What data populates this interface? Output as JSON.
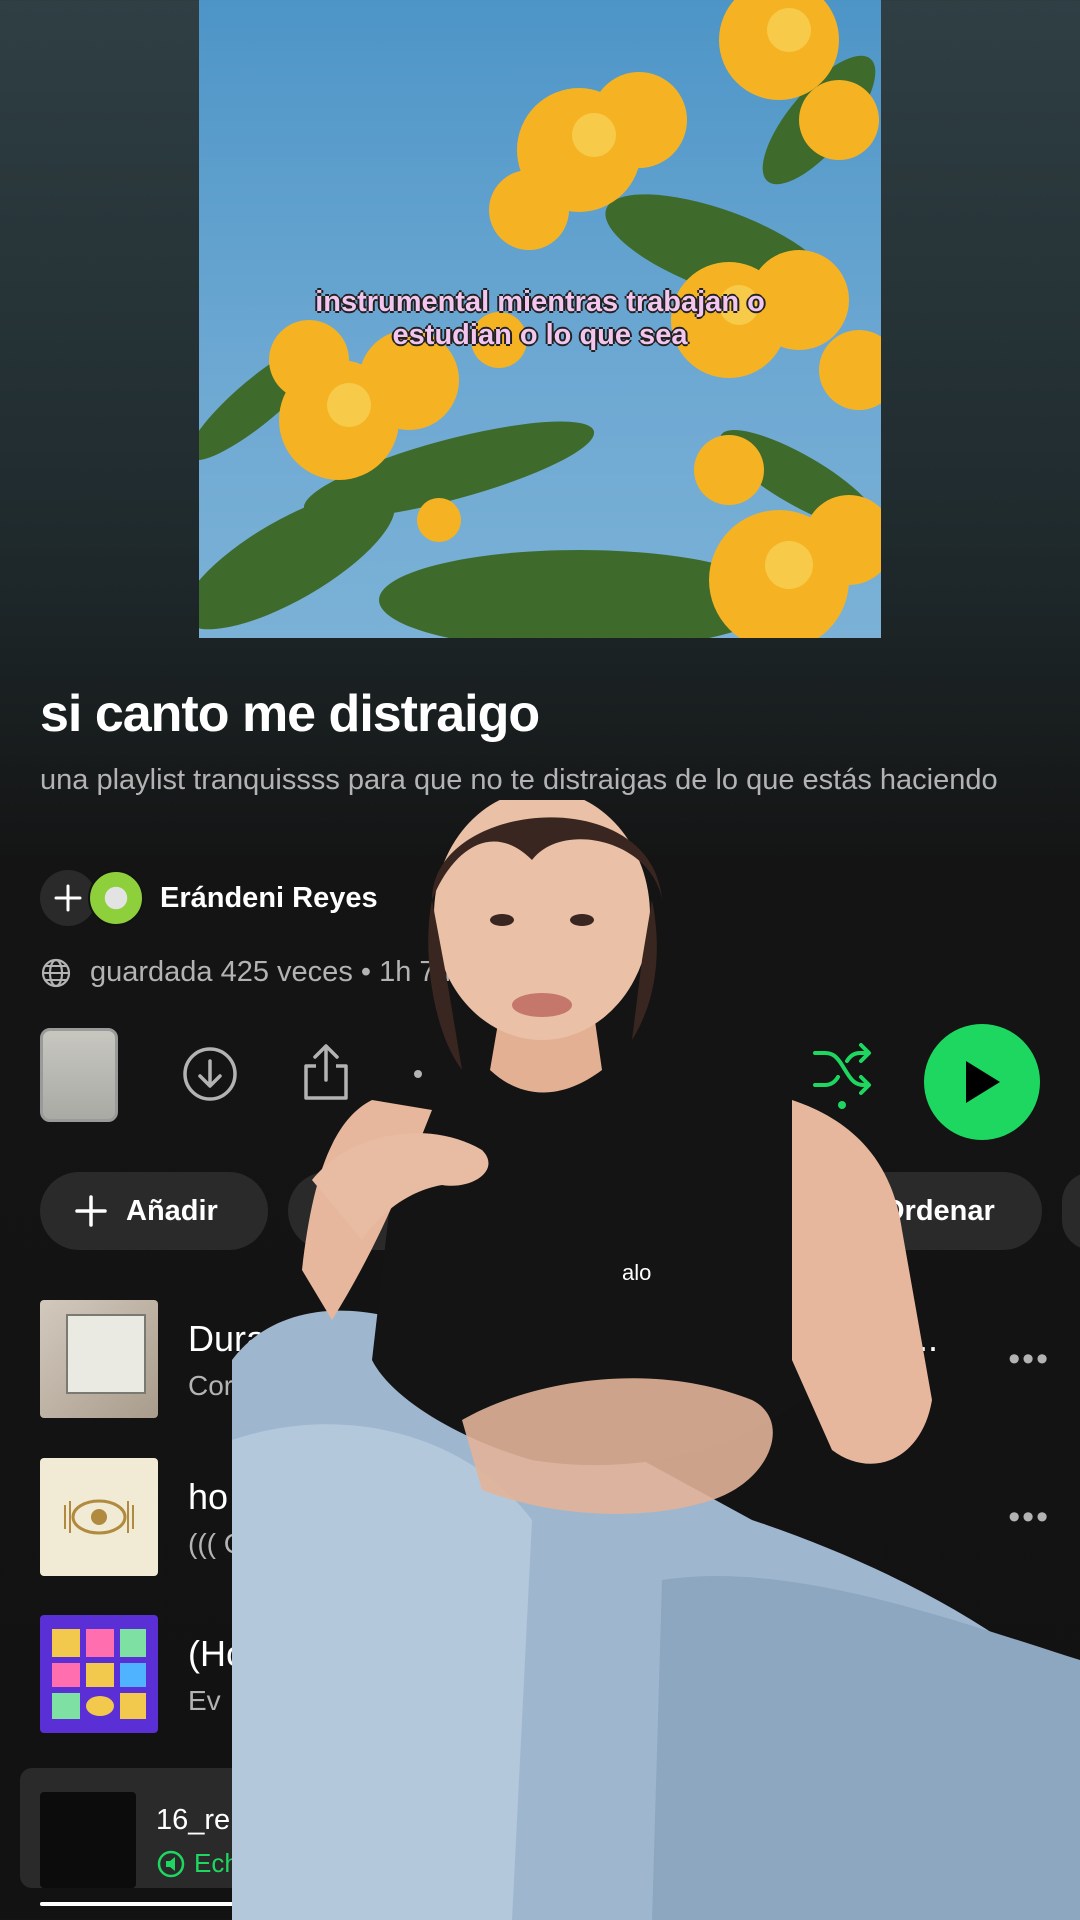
{
  "cover": {
    "caption": "instrumental mientras trabajan o estudian o lo que sea"
  },
  "playlist": {
    "title": "si canto me distraigo",
    "description": "una playlist tranquissss para que no te distraigas de lo que estás haciendo",
    "owner": "Erándeni Reyes",
    "meta": "guardada 425 veces • 1h 7m"
  },
  "actions": {
    "icons": [
      "playlist-thumbnail",
      "download-icon",
      "share-icon",
      "more-icon",
      "shuffle-icon",
      "play-icon"
    ],
    "shuffle_color": "#1ed760",
    "play_color": "#1ed760"
  },
  "chips": {
    "add_label": "Añadir",
    "sort_label": "Ordenar"
  },
  "tracks": [
    {
      "title": "Duran",
      "title_tail": "C...",
      "subtitle": "Cor"
    },
    {
      "title": "ho",
      "subtitle": "((( C"
    },
    {
      "title": "(Ho",
      "subtitle": "Ev"
    }
  ],
  "now_playing": {
    "title": "16_re",
    "device": "Ech",
    "progress": 0.2
  }
}
